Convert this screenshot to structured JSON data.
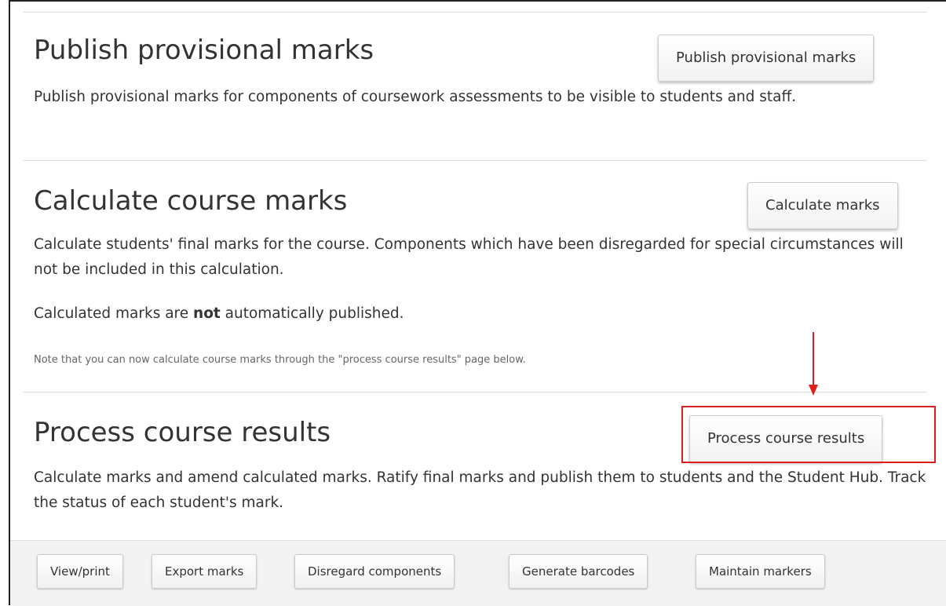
{
  "publish_section": {
    "heading": "Publish provisional marks",
    "button_label": "Publish provisional marks",
    "description": "Publish provisional marks for components of coursework assessments to be visible to students and staff."
  },
  "calculate_section": {
    "heading": "Calculate course marks",
    "button_label": "Calculate marks",
    "description": "Calculate students' final marks for the course. Components which have been disregarded for special circumstances will not be included in this calculation.",
    "published_note_before": "Calculated marks are ",
    "published_note_bold": "not",
    "published_note_after": " automatically published.",
    "small_note": "Note that you can now calculate course marks through the \"process course results\" page below."
  },
  "process_section": {
    "heading": "Process course results",
    "button_label": "Process course results",
    "description": "Calculate marks and amend calculated marks. Ratify final marks and publish them to students and the Student Hub. Track the status of each student's mark."
  },
  "annotation": {
    "color": "#e01e1e"
  },
  "footer": {
    "buttons": [
      {
        "label": "View/print"
      },
      {
        "label": "Export marks"
      },
      {
        "label": "Disregard components"
      },
      {
        "label": "Generate barcodes"
      },
      {
        "label": "Maintain markers"
      }
    ]
  }
}
